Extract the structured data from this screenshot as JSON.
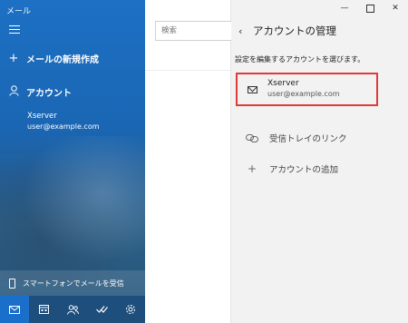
{
  "app": {
    "title": "メール"
  },
  "sidebar": {
    "new_mail_label": "メールの新規作成",
    "accounts_label": "アカウント",
    "account": {
      "name": "Xserver",
      "email": "user@example.com"
    },
    "phone_label": "スマートフォンでメールを受信",
    "bottom_icons": [
      "mail-icon",
      "calendar-icon",
      "people-icon",
      "todo-icon",
      "settings-icon"
    ]
  },
  "search": {
    "placeholder": "検索"
  },
  "panel": {
    "title": "アカウントの管理",
    "hint": "設定を編集するアカウントを選びます。",
    "account": {
      "name": "Xserver",
      "email": "user@example.com"
    },
    "link_inboxes_label": "受信トレイのリンク",
    "add_account_label": "アカウントの追加"
  },
  "colors": {
    "accent": "#1a6fcb",
    "highlight": "#e03a3a"
  }
}
